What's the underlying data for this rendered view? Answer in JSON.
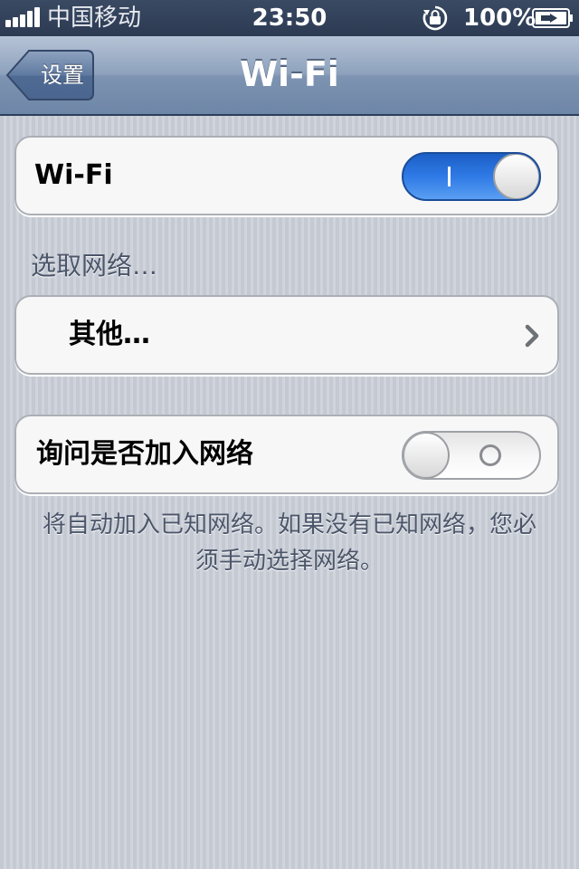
{
  "status_bar": {
    "carrier": "中国移动",
    "time": "23:50",
    "battery": "100%",
    "icons": [
      "signal-icon",
      "rotation-lock-icon",
      "battery-charging-icon"
    ]
  },
  "nav": {
    "back_label": "设置",
    "title": "Wi-Fi"
  },
  "wifi_row": {
    "label": "Wi-Fi",
    "toggle_on": true
  },
  "networks": {
    "header": "选取网络…",
    "other_label": "其他…",
    "other_icon": "chevron-right-icon"
  },
  "ask_row": {
    "label": "询问是否加入网络",
    "toggle_on": false
  },
  "footer": "将自动加入已知网络。如果没有已知网络，您必须手动选择网络。",
  "colors": {
    "toggle_on": "#2f7ae6",
    "nav_bar": "#8ea2bd",
    "status_bar": "#2c3a52"
  }
}
